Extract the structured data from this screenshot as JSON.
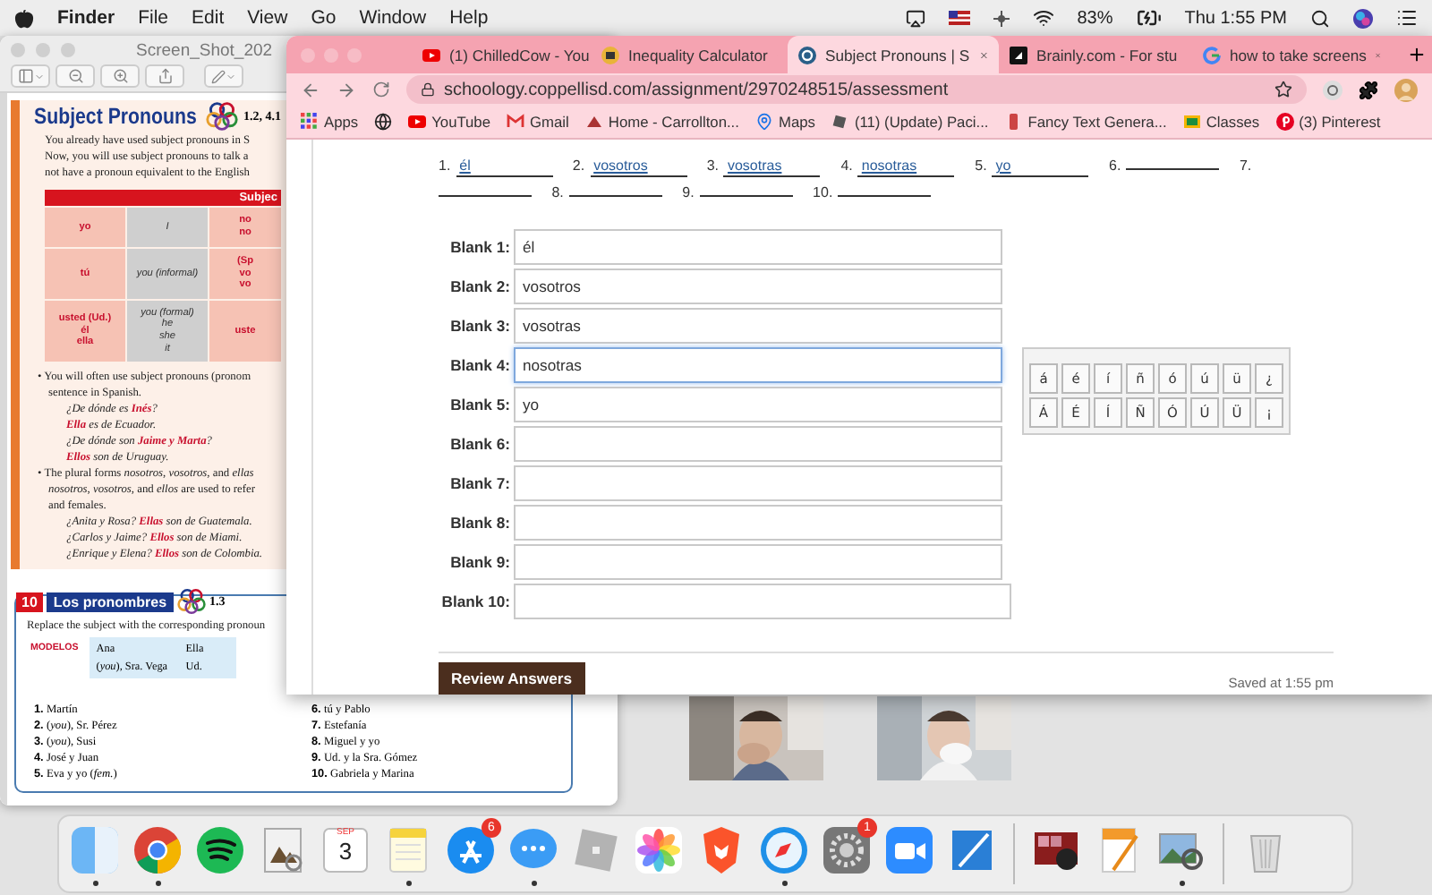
{
  "menu_bar": {
    "app": "Finder",
    "menus": [
      "File",
      "Edit",
      "View",
      "Go",
      "Window",
      "Help"
    ],
    "battery": "83%",
    "clock": "Thu 1:55 PM"
  },
  "preview": {
    "title": "Screen_Shot_202",
    "heading": "Subject Pronouns",
    "heading_ref": "1.2, 4.1",
    "intro": [
      "You already have used subject pronouns in S",
      "Now, you will use subject pronouns to talk a",
      "not have a pronoun equivalent to the English"
    ],
    "table": {
      "header": "Subjec",
      "rows": [
        [
          [
            "yo"
          ],
          [
            "I"
          ],
          [
            "no",
            "no"
          ]
        ],
        [
          [
            "tú"
          ],
          [
            "you (informal)"
          ],
          [
            "(Sp",
            "vo",
            "vo"
          ]
        ],
        [
          [
            "usted (Ud.)",
            "él",
            "ella"
          ],
          [
            "you (formal)",
            "he",
            "she",
            "it"
          ],
          [
            "uste"
          ]
        ]
      ]
    },
    "bullets": [
      {
        "lines": [
          "• You will often use subject pronouns (pronom",
          "sentence in Spanish."
        ],
        "examples": [
          "¿De dónde es **Inés**?",
          "**Ella** es de Ecuador.",
          "¿De dónde son **Jaime y Marta**?",
          "**Ellos** son de Uruguay."
        ]
      },
      {
        "lines": [
          "• The plural forms *nosotros*, *vosotros*, and *ellas*",
          "*nosotros*, *vosotros*, and *ellos* are used to refer",
          "and females."
        ],
        "examples": [
          "¿Anita y Rosa? **Ellas** son de Guatemala.",
          "¿Carlos y Jaime? **Ellos** son de Miami.",
          "¿Enrique y Elena? **Ellos** son de Colombia."
        ]
      }
    ],
    "exercise": {
      "number": "10",
      "title": "Los pronombres",
      "ref": "1.3",
      "instruction": "Replace the subject with the corresponding pronoun",
      "models_label": "MODELOS",
      "models": [
        [
          "Ana",
          "Ella"
        ],
        [
          "(*you*), Sra. Vega",
          "Ud."
        ]
      ],
      "items": [
        {
          "number": "1.",
          "text": "Martín"
        },
        {
          "number": "2.",
          "text": "(*you*), Sr. Pérez"
        },
        {
          "number": "3.",
          "text": "(*you*), Susi"
        },
        {
          "number": "4.",
          "text": "José y Juan"
        },
        {
          "number": "5.",
          "text": "Eva y yo (*fem.*)"
        },
        {
          "number": "6.",
          "text": "tú y Pablo"
        },
        {
          "number": "7.",
          "text": "Estefanía"
        },
        {
          "number": "8.",
          "text": "Miguel y yo"
        },
        {
          "number": "9.",
          "text": "Ud. y la Sra. Gómez"
        },
        {
          "number": "10.",
          "text": "Gabriela y Marina"
        }
      ]
    }
  },
  "browser": {
    "tabs": [
      {
        "title": "(1) ChilledCow - You",
        "kind": "youtube",
        "selected": false
      },
      {
        "title": "Inequality Calculator",
        "kind": "calculator",
        "selected": false
      },
      {
        "title": "Subject Pronouns | S",
        "kind": "schoology",
        "selected": true
      },
      {
        "title": "Brainly.com - For stu",
        "kind": "brainly",
        "selected": false
      },
      {
        "title": "how to take screens",
        "kind": "google",
        "selected": false
      }
    ],
    "url": "schoology.coppellisd.com/assignment/2970248515/assessment",
    "bookmarks": [
      {
        "label": "Apps",
        "kind": "grid"
      },
      {
        "kind": "globe"
      },
      {
        "label": "YouTube",
        "kind": "youtube"
      },
      {
        "label": "Gmail",
        "kind": "gmail"
      },
      {
        "label": "Home - Carrollton...",
        "kind": "school"
      },
      {
        "label": "Maps",
        "kind": "maps"
      },
      {
        "label": "(11) (Update) Paci...",
        "kind": "cube"
      },
      {
        "label": "Fancy Text Genera...",
        "kind": "phone"
      },
      {
        "label": "Classes",
        "kind": "classroom"
      },
      {
        "label": "(3) Pinterest",
        "kind": "pinterest"
      }
    ]
  },
  "page": {
    "answers": [
      {
        "number": "1.",
        "value": "él"
      },
      {
        "number": "2.",
        "value": "vosotros"
      },
      {
        "number": "3.",
        "value": "vosotras"
      },
      {
        "number": "4.",
        "value": "nosotras"
      },
      {
        "number": "5.",
        "value": "yo"
      },
      {
        "number": "6."
      },
      {
        "number": "7."
      },
      {
        "number": "8."
      },
      {
        "number": "9."
      },
      {
        "number": "10."
      }
    ],
    "blanks": [
      {
        "label": "Blank 1:",
        "value": "él",
        "focused": false
      },
      {
        "label": "Blank 2:",
        "value": "vosotros",
        "focused": false
      },
      {
        "label": "Blank 3:",
        "value": "vosotras",
        "focused": false
      },
      {
        "label": "Blank 4:",
        "value": "nosotras",
        "focused": true
      },
      {
        "label": "Blank 5:",
        "value": "yo",
        "focused": false
      },
      {
        "label": "Blank 6:",
        "focused": false
      },
      {
        "label": "Blank 7:",
        "focused": false
      },
      {
        "label": "Blank 8:",
        "focused": false
      },
      {
        "label": "Blank 9:",
        "focused": false
      },
      {
        "label": "Blank 10:",
        "focused": false
      }
    ],
    "keyboard": [
      [
        "á",
        "é",
        "í",
        "ñ",
        "ó",
        "ú",
        "ü",
        "¿"
      ],
      [
        "Á",
        "É",
        "Í",
        "Ñ",
        "Ó",
        "Ú",
        "Ü",
        "¡"
      ]
    ],
    "review_button": "Review Answers",
    "saved": "Saved at 1:55 pm"
  },
  "dock": [
    {
      "kind": "finder",
      "running": true
    },
    {
      "kind": "chrome",
      "running": true
    },
    {
      "kind": "spotify",
      "running": false
    },
    {
      "kind": "preview",
      "running": false
    },
    {
      "kind": "calendar",
      "running": false,
      "month": "SEP",
      "day": "3"
    },
    {
      "kind": "notes",
      "running": true
    },
    {
      "kind": "appstore",
      "running": false,
      "badge": "6"
    },
    {
      "kind": "messages",
      "running": true
    },
    {
      "kind": "cube",
      "running": false
    },
    {
      "kind": "photos",
      "running": false
    },
    {
      "kind": "brave",
      "running": false
    },
    {
      "kind": "safari",
      "running": true
    },
    {
      "kind": "settings",
      "running": false,
      "badge": "1"
    },
    {
      "kind": "zoom",
      "running": false
    },
    {
      "kind": "studio",
      "running": false
    },
    {
      "kind": "separator"
    },
    {
      "kind": "photobooth",
      "running": false
    },
    {
      "kind": "pages",
      "running": false
    },
    {
      "kind": "viewer",
      "running": true
    },
    {
      "kind": "separator"
    },
    {
      "kind": "trash",
      "running": false
    }
  ]
}
